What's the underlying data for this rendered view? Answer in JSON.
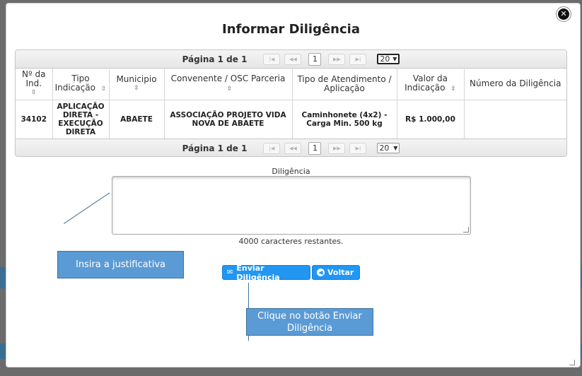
{
  "modal": {
    "title": "Informar Diligência",
    "close_icon": "close-circle-icon"
  },
  "pager": {
    "page_info": "Página 1 de 1",
    "first_icon": "first-page-icon",
    "first_glyph": "|◀",
    "prev_icon": "prev-page-icon",
    "prev_glyph": "◀◀",
    "next_icon": "next-page-icon",
    "next_glyph": "▶▶",
    "last_icon": "last-page-icon",
    "last_glyph": "▶|",
    "current_page": "1",
    "page_size": "20"
  },
  "table": {
    "columns": [
      {
        "label": "Nº da Ind.",
        "sort_icon": "⇳"
      },
      {
        "label": "Tipo Indicação",
        "sort_icon": "⇳"
      },
      {
        "label": "Municipio",
        "sort_icon": "⇳"
      },
      {
        "label": "Convenente / OSC Parceria",
        "sort_icon": "⇳"
      },
      {
        "label": "Tipo de Atendimento / Aplicação",
        "sort_icon": ""
      },
      {
        "label": "Valor da Indicação",
        "sort_icon": "⇳"
      },
      {
        "label": "Número da Diligência",
        "sort_icon": ""
      }
    ],
    "rows": [
      [
        "34102",
        "APLICAÇÃO DIRETA - EXECUÇÃO DIRETA",
        "ABAETE",
        "ASSOCIAÇÃO PROJETO VIDA NOVA DE ABAETE",
        "Caminhonete (4x2) - Carga Min. 500 kg",
        "R$ 1.000,00",
        ""
      ]
    ]
  },
  "form": {
    "label": "Diligência",
    "value": "",
    "chars_remaining": "4000 caracteres restantes."
  },
  "buttons": {
    "send_label": "Enviar Diligência",
    "send_icon": "envelope-icon",
    "back_label": "Voltar",
    "back_icon": "arrow-left-circle-icon"
  },
  "callouts": {
    "justify": "Insira a justificativa",
    "click_send": "Clique no botão Enviar Diligência"
  },
  "colors": {
    "button": "#2196f3",
    "callout": "#5b9bd5",
    "overlay": "#6b6b6b"
  }
}
